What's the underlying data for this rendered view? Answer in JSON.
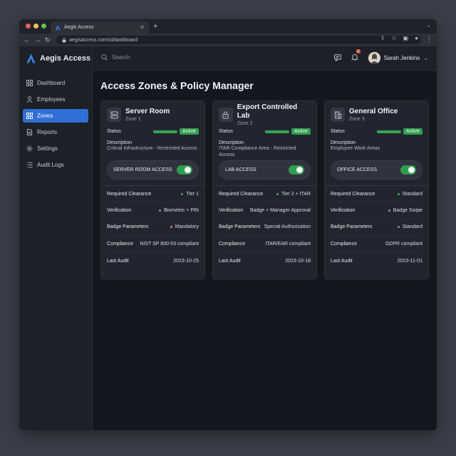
{
  "browser": {
    "tab_title": "Aegis Access",
    "url": "aegisaccess.com/ui/dashboard"
  },
  "brand": {
    "name": "Aegis Access",
    "accent": "#3f7ee8"
  },
  "sidebar": {
    "items": [
      {
        "label": "Dashboard",
        "icon": "grid-icon",
        "active": false
      },
      {
        "label": "Employees",
        "icon": "user-icon",
        "active": false
      },
      {
        "label": "Zones",
        "icon": "grid-icon",
        "active": true
      },
      {
        "label": "Reports",
        "icon": "document-icon",
        "active": false
      },
      {
        "label": "Settings",
        "icon": "gear-icon",
        "active": false
      },
      {
        "label": "Audit Logs",
        "icon": "list-icon",
        "active": false
      }
    ]
  },
  "topbar": {
    "search_placeholder": "Search",
    "user_name": "Sarah Jenkins"
  },
  "page": {
    "title": "Access Zones & Policy Manager"
  },
  "field_labels": {
    "status": "Status",
    "description": "Description",
    "required_clearance": "Required Clearance",
    "verification": "Verification",
    "badge_parameters": "Badge Parameters",
    "compliance": "Compliance",
    "last_audit": "Last Audit"
  },
  "colors": {
    "active_green": "#2f9e4f",
    "dot_green": "#3bb35a",
    "dot_gray": "#8a8f9a",
    "dot_orange": "#e0844a"
  },
  "zones": [
    {
      "name": "Server Room",
      "zone": "Zone 1",
      "icon": "server-icon",
      "status": "Active",
      "description": "Critical Infrastructure - Restricted Access",
      "access_label": "SERVER ROOM ACCESS",
      "access_enabled": true,
      "required_clearance": "Tier 1",
      "clearance_dot": "#3bb35a",
      "verification": "Biometric + PIN",
      "verification_dot": "#8a8f9a",
      "badge_parameters": "Mandatory",
      "badge_dot": "#e0844a",
      "compliance": "NIST SP 800-53 compliant",
      "last_audit": "2023-10-25"
    },
    {
      "name": "Export Controlled Lab",
      "zone": "Zone 2",
      "icon": "lock-icon",
      "status": "Active",
      "description": "ITAR Compliance Area - Restricted Access",
      "access_label": "LAB ACCESS",
      "access_enabled": true,
      "required_clearance": "Tier 2 + ITAR",
      "clearance_dot": "#3bb35a",
      "verification": "Badge + Manager Approval",
      "verification_dot": "",
      "badge_parameters": "Special Authorization",
      "badge_dot": "",
      "compliance": "ITAR/EAR compliant",
      "last_audit": "2023-10-18"
    },
    {
      "name": "General Office",
      "zone": "Zone 3",
      "icon": "building-icon",
      "status": "Active",
      "description": "Employee Work Areas",
      "access_label": "OFFICE ACCESS",
      "access_enabled": true,
      "required_clearance": "Standard",
      "clearance_dot": "#3bb35a",
      "verification": "Badge Swipe",
      "verification_dot": "#8a8f9a",
      "badge_parameters": "Standard",
      "badge_dot": "#8a8f9a",
      "compliance": "GDPR compliant",
      "last_audit": "2023-11-01"
    }
  ]
}
